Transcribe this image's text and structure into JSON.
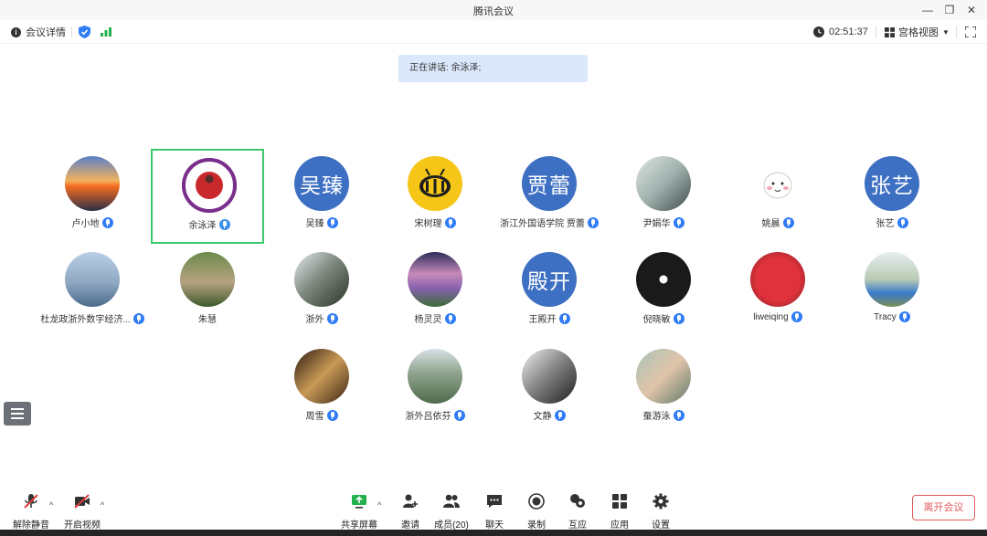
{
  "app": {
    "title": "腾讯会议"
  },
  "window_controls": {
    "minimize": "—",
    "restore": "❐",
    "close": "✕"
  },
  "toolbar": {
    "meeting_details": "会议详情",
    "timer": "02:51:37",
    "view_mode": "宫格视图"
  },
  "speaking": {
    "text": "正在讲话: 余泳泽;"
  },
  "participants": [
    {
      "name": "卢小地",
      "avatar": "sunset-photo"
    },
    {
      "name": "余泳泽",
      "avatar": "nankai-university-seal",
      "active": true
    },
    {
      "name": "吴臻",
      "avatar_text": "吴臻"
    },
    {
      "name": "宋树理",
      "avatar": "bee-cartoon"
    },
    {
      "name": "浙江外国语学院 贾蕾",
      "avatar_text": "贾蕾"
    },
    {
      "name": "尹娟华",
      "avatar": "person-photo"
    },
    {
      "name": "姚晨",
      "avatar": "cartoon-cat"
    },
    {
      "name": "张艺",
      "avatar_text": "张艺"
    },
    {
      "name": "杜龙政浙外数字经济...",
      "avatar": "lake-photo"
    },
    {
      "name": "朱慧",
      "avatar": "garden-photo",
      "muted_icon": false
    },
    {
      "name": "浙外",
      "avatar": "building-photo"
    },
    {
      "name": "杨灵灵",
      "avatar": "lavender-photo"
    },
    {
      "name": "王殿开",
      "avatar_text": "殿开"
    },
    {
      "name": "倪晓敏",
      "avatar": "flowers-photo"
    },
    {
      "name": "liweiqing",
      "avatar": "red-tree-photo"
    },
    {
      "name": "Tracy",
      "avatar": "person-outdoor-photo"
    },
    {
      "name": "周雪",
      "avatar": "painting-photo"
    },
    {
      "name": "浙外吕依芬",
      "avatar": "mountain-photo"
    },
    {
      "name": "文静",
      "avatar": "bw-photo"
    },
    {
      "name": "蚕游泳",
      "avatar": "mother-child-photo"
    }
  ],
  "bottom": {
    "unmute": "解除静音",
    "start_video": "开启视频",
    "share_screen": "共享屏幕",
    "invite": "邀请",
    "members": "成员(20)",
    "chat": "聊天",
    "record": "录制",
    "interact": "互应",
    "apps": "应用",
    "settings": "设置",
    "leave": "离开会议"
  },
  "colors": {
    "accent_blue": "#2f7cf6",
    "avatar_blue": "#3d6fc2",
    "active_border": "#3cc86e",
    "leave_red": "#e25c5c",
    "speaking_bg": "#dbe8fb"
  }
}
